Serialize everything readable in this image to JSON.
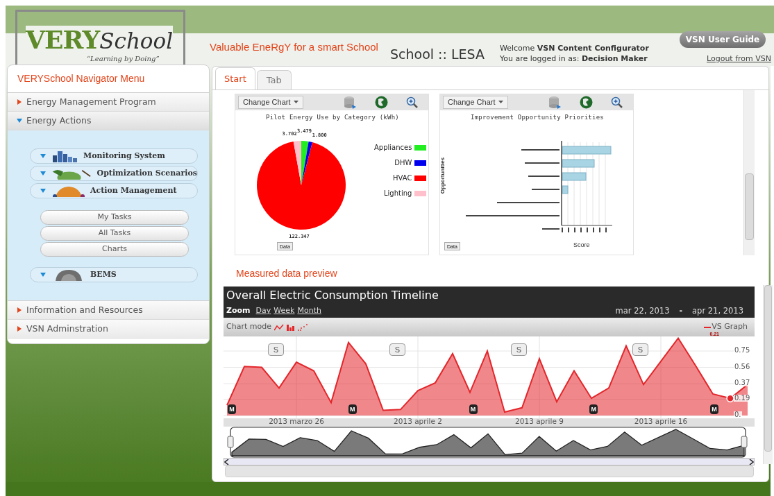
{
  "header": {
    "logo_word_1": "VERY",
    "logo_word_2": "School",
    "logo_tagline": "“Learning by Doing”",
    "slogan": "Valuable EneRgY for a smart School",
    "school": "School :: LESA",
    "welcome": "Welcome **VSN Content Configurator**",
    "logged_in": "You are logged in as: **Decision Maker**",
    "guide_button": "VSN User Guide",
    "logout_link": "Logout from VSN"
  },
  "sidebar": {
    "title": "VERYSchool Navigator Menu",
    "sections": [
      {
        "label": "Energy Management Program",
        "expanded": false
      },
      {
        "label": "Energy Actions",
        "expanded": true,
        "children": [
          {
            "label": "Monitoring System"
          },
          {
            "label": "Optimization Scenarios"
          },
          {
            "label": "Action Management",
            "children": [
              {
                "label": "My Tasks"
              },
              {
                "label": "All Tasks"
              },
              {
                "label": "Charts"
              }
            ]
          },
          {
            "label": "BEMS"
          }
        ]
      },
      {
        "label": "Information and Resources",
        "expanded": false
      },
      {
        "label": "VSN Adminstration",
        "expanded": false
      }
    ]
  },
  "tabs": [
    {
      "label": "Start",
      "selected": true
    },
    {
      "label": "Tab",
      "selected": false
    }
  ],
  "chart_panels": [
    {
      "kind": "pie",
      "button": "Change Chart",
      "data_button": "Data",
      "chart_data": {
        "type": "pie",
        "title": "Pilot Energy Use by Category (kWh)",
        "categories": [
          "Appliances",
          "DHW",
          "HVAC",
          "Lighting"
        ],
        "colors": [
          "#22ee22",
          "#0000ee",
          "#ff0000",
          "#ffc0cb"
        ],
        "values": [
          3.479,
          1.8,
          122.347,
          3.702
        ],
        "value_labels": [
          "3.479",
          "1.800",
          "122.347",
          "3.702"
        ],
        "legend": "right"
      }
    },
    {
      "kind": "bar",
      "button": "Change Chart",
      "data_button": "Data",
      "title": "Improvement Opportunity Priorities",
      "xlabel": "Score",
      "ylabel": "Opportunities"
    }
  ],
  "timeline": {
    "section_title": "Measured data preview",
    "title": "Overall Electric Consumption Timeline",
    "zoom_label": "Zoom",
    "zoom_options": [
      "Day",
      "Week",
      "Month"
    ],
    "date_from": "mar 22, 2013",
    "date_separator": "-",
    "date_to": "apr 21, 2013",
    "chart_mode_label": "Chart mode",
    "current_value": "0.21",
    "chart_data": {
      "type": "area",
      "categories": [
        null,
        null,
        null,
        null,
        "2013 marzo 26",
        null,
        null,
        null,
        null,
        null,
        null,
        "2013 aprile 2",
        null,
        null,
        null,
        null,
        null,
        null,
        "2013 aprile 9",
        null,
        null,
        null,
        null,
        null,
        null,
        "2013 aprile 16",
        null,
        null,
        null,
        null,
        null
      ],
      "series": [
        {
          "name": "VS Graph",
          "color": "#e3262b",
          "values": [
            0.12,
            0.57,
            0.56,
            0.32,
            0.62,
            0.52,
            0.15,
            0.85,
            0.6,
            0.06,
            0.07,
            0.29,
            0.38,
            0.72,
            0.27,
            0.75,
            0.04,
            0.09,
            0.66,
            0.16,
            0.52,
            0.2,
            0.32,
            0.81,
            0.36,
            0.63,
            0.9,
            0.58,
            0.25,
            0.2,
            0.36
          ]
        }
      ],
      "ylim": [
        0,
        0.9
      ],
      "yticks": [
        {
          "value": 0,
          "label": "0."
        },
        {
          "value": 0.19,
          "label": "0.19"
        },
        {
          "value": 0.37,
          "label": "0.37"
        },
        {
          "value": 0.56,
          "label": "0.56"
        },
        {
          "value": 0.75,
          "label": "0.75"
        }
      ],
      "grid": true
    },
    "top_flags": [
      "S",
      "S",
      "S",
      "S"
    ],
    "bottom_flags": [
      "M",
      "M",
      "M",
      "M",
      "M"
    ]
  }
}
